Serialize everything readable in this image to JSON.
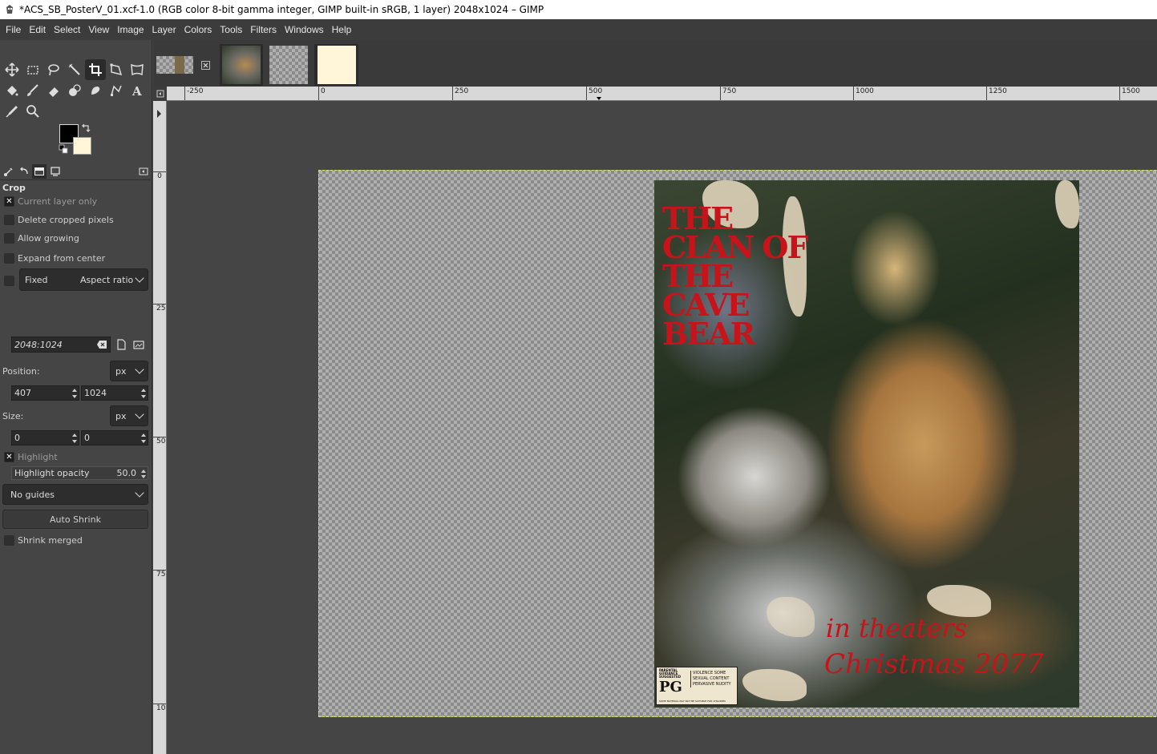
{
  "window": {
    "title": "*ACS_SB_PosterV_01.xcf-1.0 (RGB color 8-bit gamma integer, GIMP built-in sRGB, 1 layer) 2048x1024 – GIMP"
  },
  "menu": [
    "File",
    "Edit",
    "Select",
    "View",
    "Image",
    "Layer",
    "Colors",
    "Tools",
    "Filters",
    "Windows",
    "Help"
  ],
  "colors": {
    "foreground": "#000000",
    "background": "#fff6d9",
    "poster_text": "#c7131a"
  },
  "tool_options": {
    "title": "Crop",
    "current_layer_only": {
      "label": "Current layer only",
      "checked": true
    },
    "delete_cropped": {
      "label": "Delete cropped pixels",
      "checked": false
    },
    "allow_growing": {
      "label": "Allow growing",
      "checked": false
    },
    "expand_center": {
      "label": "Expand from center",
      "checked": false
    },
    "fixed": {
      "label": "Fixed",
      "mode": "Aspect ratio",
      "checked": false
    },
    "ratio_value": "2048:1024",
    "position_label": "Position:",
    "position_unit": "px",
    "position_x": "407",
    "position_y": "1024",
    "size_label": "Size:",
    "size_unit": "px",
    "size_w": "0",
    "size_h": "0",
    "highlight": {
      "label": "Highlight",
      "checked": true
    },
    "highlight_opacity_label": "Highlight opacity",
    "highlight_opacity_value": "50.0",
    "guides": "No guides",
    "auto_shrink": "Auto Shrink",
    "shrink_merged": {
      "label": "Shrink merged",
      "checked": false
    }
  },
  "rulers": {
    "horizontal": [
      "-250",
      "0",
      "250",
      "500",
      "750",
      "1000",
      "1250",
      "1500"
    ],
    "vertical": [
      "0",
      "250",
      "500",
      "750",
      "1000"
    ]
  },
  "poster": {
    "title": "THE CLAN OF THE CAVE BEAR",
    "tagline_1": "in theaters",
    "tagline_2": "Christmas 2077",
    "rating_header": "PARENTAL GUIDANCE SUGGESTED",
    "rating": "PG",
    "rating_reasons": "VIOLENCE SOME SEXUAL CONTENT PERVASIVE NUDITY",
    "rating_footer": "SOME MATERIAL MAY NOT BE SUITABLE FOR CHILDREN"
  }
}
